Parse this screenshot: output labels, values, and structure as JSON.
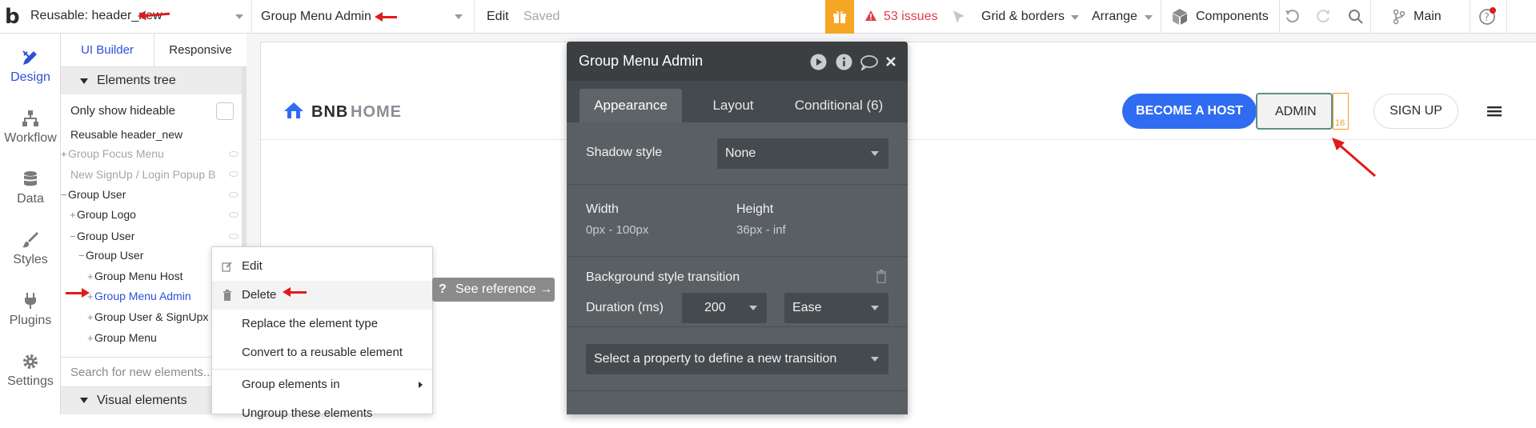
{
  "topbar": {
    "logo": "b",
    "page_selector": "Reusable: header_new",
    "element_selector": "Group Menu Admin",
    "edit_label": "Edit",
    "saved_label": "Saved",
    "issues_label": "53 issues",
    "grid_label": "Grid & borders",
    "arrange_label": "Arrange",
    "components_label": "Components",
    "branch_label": "Main",
    "issues_color": "#e03c4b",
    "gift_color": "#f5a623"
  },
  "leftnav": {
    "items": [
      {
        "label": "Design",
        "icon": "design-pencil-icon"
      },
      {
        "label": "Workflow",
        "icon": "workflow-tree-icon"
      },
      {
        "label": "Data",
        "icon": "database-icon"
      },
      {
        "label": "Styles",
        "icon": "brush-icon"
      },
      {
        "label": "Plugins",
        "icon": "plug-icon"
      },
      {
        "label": "Settings",
        "icon": "gear-icon"
      }
    ],
    "active_color": "#2c50d6"
  },
  "panel": {
    "tab_ui_builder": "UI Builder",
    "tab_responsive": "Responsive",
    "elements_tree_label": "Elements tree",
    "only_hideable_label": "Only show hideable",
    "tree": [
      {
        "label": "Reusable header_new",
        "prefix": ""
      },
      {
        "label": "Group Focus Menu",
        "prefix": "+"
      },
      {
        "label": "New SignUp / Login Popup B",
        "prefix": ""
      },
      {
        "label": "Group User",
        "prefix": "−"
      },
      {
        "label": "Group Logo",
        "prefix": "+"
      },
      {
        "label": "Group User",
        "prefix": "−"
      },
      {
        "label": "Group User",
        "prefix": "−"
      },
      {
        "label": "Group Menu Host",
        "prefix": "+"
      },
      {
        "label": "Group Menu Admin",
        "prefix": "+"
      },
      {
        "label": "Group User & SignUpx",
        "prefix": "+"
      },
      {
        "label": "Group Menu",
        "prefix": "+"
      }
    ],
    "search_placeholder": "Search for new elements...",
    "visual_elements_label": "Visual elements"
  },
  "context_menu": {
    "items": [
      "Edit",
      "Delete",
      "Replace the element type",
      "Convert to a reusable element",
      "Group elements in",
      "Ungroup these elements"
    ]
  },
  "see_reference": "See reference →",
  "canvas": {
    "logo_bnb": "BNB",
    "logo_home": "HOME",
    "become_host": "BECOME A HOST",
    "admin": "ADMIN",
    "sign_up": "SIGN UP",
    "padding_badge": "16",
    "brand_blue": "#2f6cf2"
  },
  "editor": {
    "title": "Group Menu Admin",
    "tabs": [
      "Appearance",
      "Layout",
      "Conditional (6)"
    ],
    "shadow_label": "Shadow style",
    "shadow_value": "None",
    "width_label": "Width",
    "width_value": "0px - 100px",
    "height_label": "Height",
    "height_value": "36px - inf",
    "bg_transition_label": "Background style transition",
    "duration_label": "Duration (ms)",
    "duration_value": "200",
    "easing_value": "Ease",
    "new_transition_label": "Select a property to define a new transition"
  }
}
